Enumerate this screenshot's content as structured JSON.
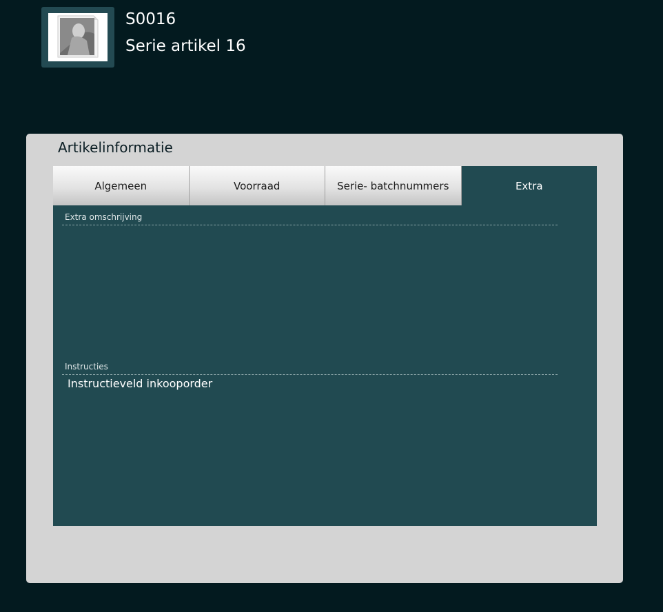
{
  "header": {
    "item_code": "S0016",
    "item_name": "Serie artikel 16",
    "thumbnail_icon": "product-image-placeholder-icon"
  },
  "panel": {
    "title": "Artikelinformatie",
    "tabs": [
      {
        "label": "Algemeen",
        "active": false
      },
      {
        "label": "Voorraad",
        "active": false
      },
      {
        "label": "Serie- batchnummers",
        "active": false
      },
      {
        "label": "Extra",
        "active": true
      }
    ],
    "fields": {
      "extra_description": {
        "label": "Extra omschrijving",
        "value": ""
      },
      "instructions": {
        "label": "Instructies",
        "value": "Instructieveld inkooporder"
      }
    }
  },
  "colors": {
    "background": "#031a1f",
    "panel": "#d4d4d4",
    "accent": "#214a51",
    "text_light": "#ffffff"
  }
}
